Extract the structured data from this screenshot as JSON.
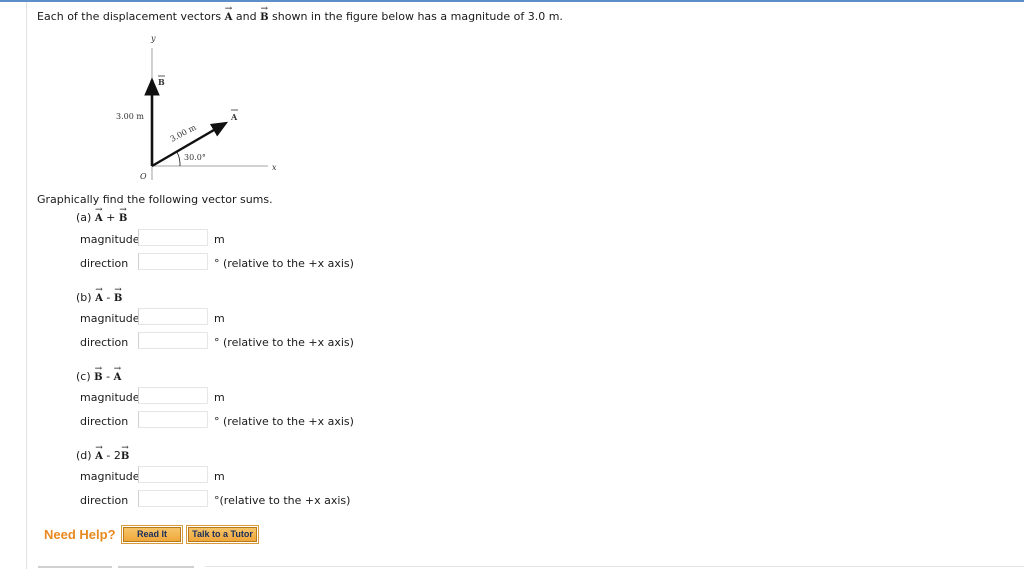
{
  "problem": {
    "text_pre": "Each of the displacement vectors ",
    "vec_a": "A",
    "text_and": " and ",
    "vec_b": "B",
    "text_post": " shown in the figure below has a magnitude of 3.0 m."
  },
  "figure": {
    "y_axis": "y",
    "x_axis": "x",
    "origin": "O",
    "b_label": "B",
    "a_label": "A",
    "b_magnitude": "3.00 m",
    "a_magnitude": "3.00 m",
    "angle": "30.0°"
  },
  "prompt": "Graphically find the following vector sums.",
  "parts": [
    {
      "tag": "(a)",
      "v1": "A",
      "op": " + ",
      "coef": "",
      "v2": "B"
    },
    {
      "tag": "(b)",
      "v1": "A",
      "op": " - ",
      "coef": "",
      "v2": "B"
    },
    {
      "tag": "(c)",
      "v1": "B",
      "op": " - ",
      "coef": "",
      "v2": "A"
    },
    {
      "tag": "(d)",
      "v1": "A",
      "op": " - ",
      "coef": "2",
      "v2": "B"
    }
  ],
  "labels": {
    "magnitude": "magnitude",
    "direction": "direction"
  },
  "units": {
    "meters": "m",
    "direction_note": "° (relative to the +x axis)",
    "direction_note_d": "°(relative to the +x axis)"
  },
  "help": {
    "need_help": "Need Help?",
    "read_it": "Read It",
    "talk_tutor": "Talk to a Tutor"
  },
  "colors": {
    "accent_line": "#5b8fc7",
    "need_help": "#e8891f",
    "button": "#f0a83a"
  }
}
